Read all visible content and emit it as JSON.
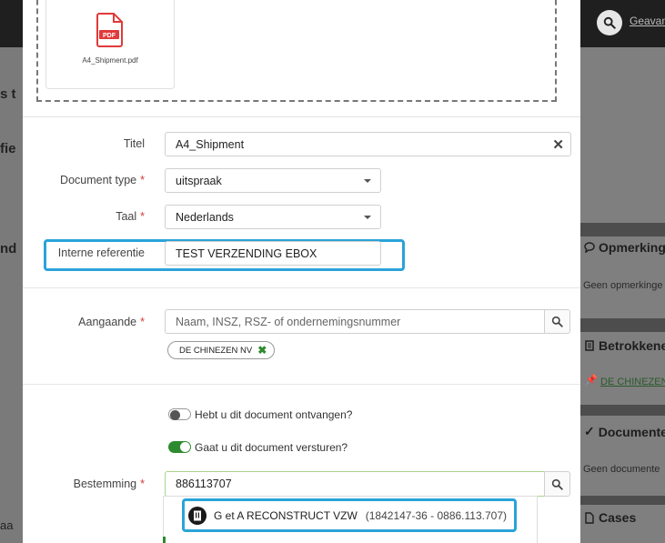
{
  "background": {
    "header_link": "Geavan",
    "left_fragments": [
      "s t",
      "fie",
      "nd",
      "aa"
    ],
    "right_panel": {
      "remarks_title": "Opmerkinge",
      "remarks_empty": "Geen opmerkinge",
      "involved_title": "Betrokkene",
      "involved_link": "DE CHINEZEN",
      "documents_title": "Documente",
      "documents_empty": "Geen documente",
      "cases_title": "Cases"
    }
  },
  "upload": {
    "file_name": "A4_Shipment.pdf",
    "file_badge": "PDF"
  },
  "form": {
    "title": {
      "label": "Titel",
      "value": "A4_Shipment"
    },
    "document_type": {
      "label": "Document type",
      "value": "uitspraak"
    },
    "language": {
      "label": "Taal",
      "value": "Nederlands"
    },
    "internal_reference": {
      "label": "Interne referentie",
      "value": "TEST VERZENDING EBOX"
    },
    "concerning": {
      "label": "Aangaande",
      "placeholder": "Naam, INSZ, RSZ- of ondernemingsnummer",
      "chips": [
        "DE CHINEZEN NV"
      ]
    },
    "received_toggle": {
      "label": "Hebt u dit document ontvangen?",
      "on": false
    },
    "send_toggle": {
      "label": "Gaat u dit document versturen?",
      "on": true
    },
    "destination": {
      "label": "Bestemming",
      "value": "886113707",
      "suggestions": [
        {
          "name": "G et A RECONSTRUCT VZW",
          "numbers": "(1842147-36 - 0886.113.707)"
        }
      ]
    }
  },
  "colors": {
    "required": "#d43a3a",
    "highlight": "#2aa3d9",
    "toggle_on": "#2e8a2e",
    "pdf_red": "#e03a3a"
  }
}
